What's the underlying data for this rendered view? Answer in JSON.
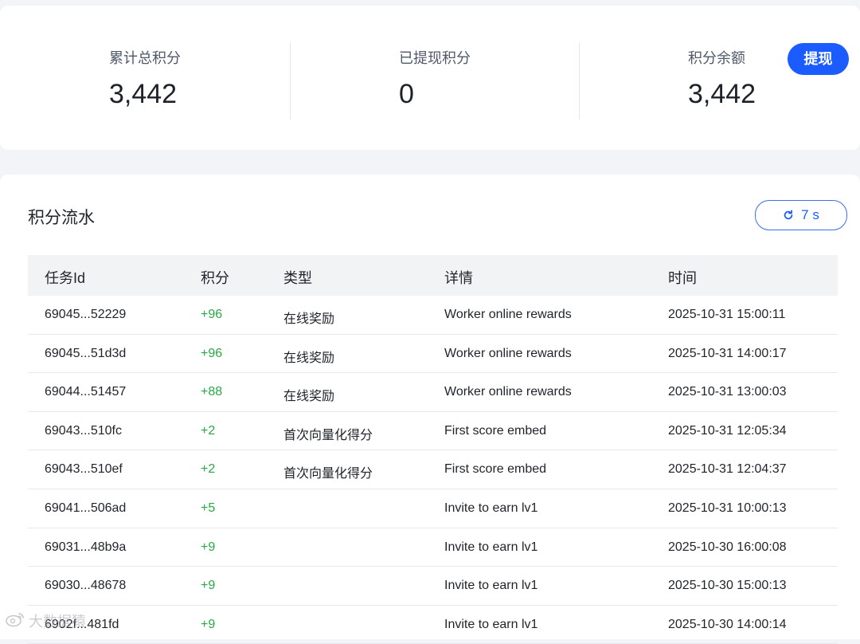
{
  "stats": {
    "total": {
      "label": "累计总积分",
      "value": "3,442"
    },
    "withdrawn": {
      "label": "已提现积分",
      "value": "0"
    },
    "balance": {
      "label": "积分余额",
      "value": "3,442"
    },
    "withdraw_button": "提现"
  },
  "ledger": {
    "title": "积分流水",
    "refresh_countdown": "7 s",
    "columns": [
      "任务Id",
      "积分",
      "类型",
      "详情",
      "时间"
    ],
    "rows": [
      {
        "id": "69045...52229",
        "points": "+96",
        "type": "在线奖励",
        "detail": "Worker online rewards",
        "time": "2025-10-31 15:00:11"
      },
      {
        "id": "69045...51d3d",
        "points": "+96",
        "type": "在线奖励",
        "detail": "Worker online rewards",
        "time": "2025-10-31 14:00:17"
      },
      {
        "id": "69044...51457",
        "points": "+88",
        "type": "在线奖励",
        "detail": "Worker online rewards",
        "time": "2025-10-31 13:00:03"
      },
      {
        "id": "69043...510fc",
        "points": "+2",
        "type": "首次向量化得分",
        "detail": "First score embed",
        "time": "2025-10-31 12:05:34"
      },
      {
        "id": "69043...510ef",
        "points": "+2",
        "type": "首次向量化得分",
        "detail": "First score embed",
        "time": "2025-10-31 12:04:37"
      },
      {
        "id": "69041...506ad",
        "points": "+5",
        "type": "",
        "detail": "Invite to earn lv1",
        "time": "2025-10-31 10:00:13"
      },
      {
        "id": "69031...48b9a",
        "points": "+9",
        "type": "",
        "detail": "Invite to earn lv1",
        "time": "2025-10-30 16:00:08"
      },
      {
        "id": "69030...48678",
        "points": "+9",
        "type": "",
        "detail": "Invite to earn lv1",
        "time": "2025-10-30 15:00:13"
      },
      {
        "id": "6902f...481fd",
        "points": "+9",
        "type": "",
        "detail": "Invite to earn lv1",
        "time": "2025-10-30 14:00:14"
      }
    ]
  },
  "watermark": {
    "text": "大数据猿"
  },
  "colors": {
    "accent": "#1a5cff",
    "positive": "#28a745",
    "header_bg": "#f2f3f5"
  },
  "icons": {
    "refresh": "refresh-icon"
  }
}
